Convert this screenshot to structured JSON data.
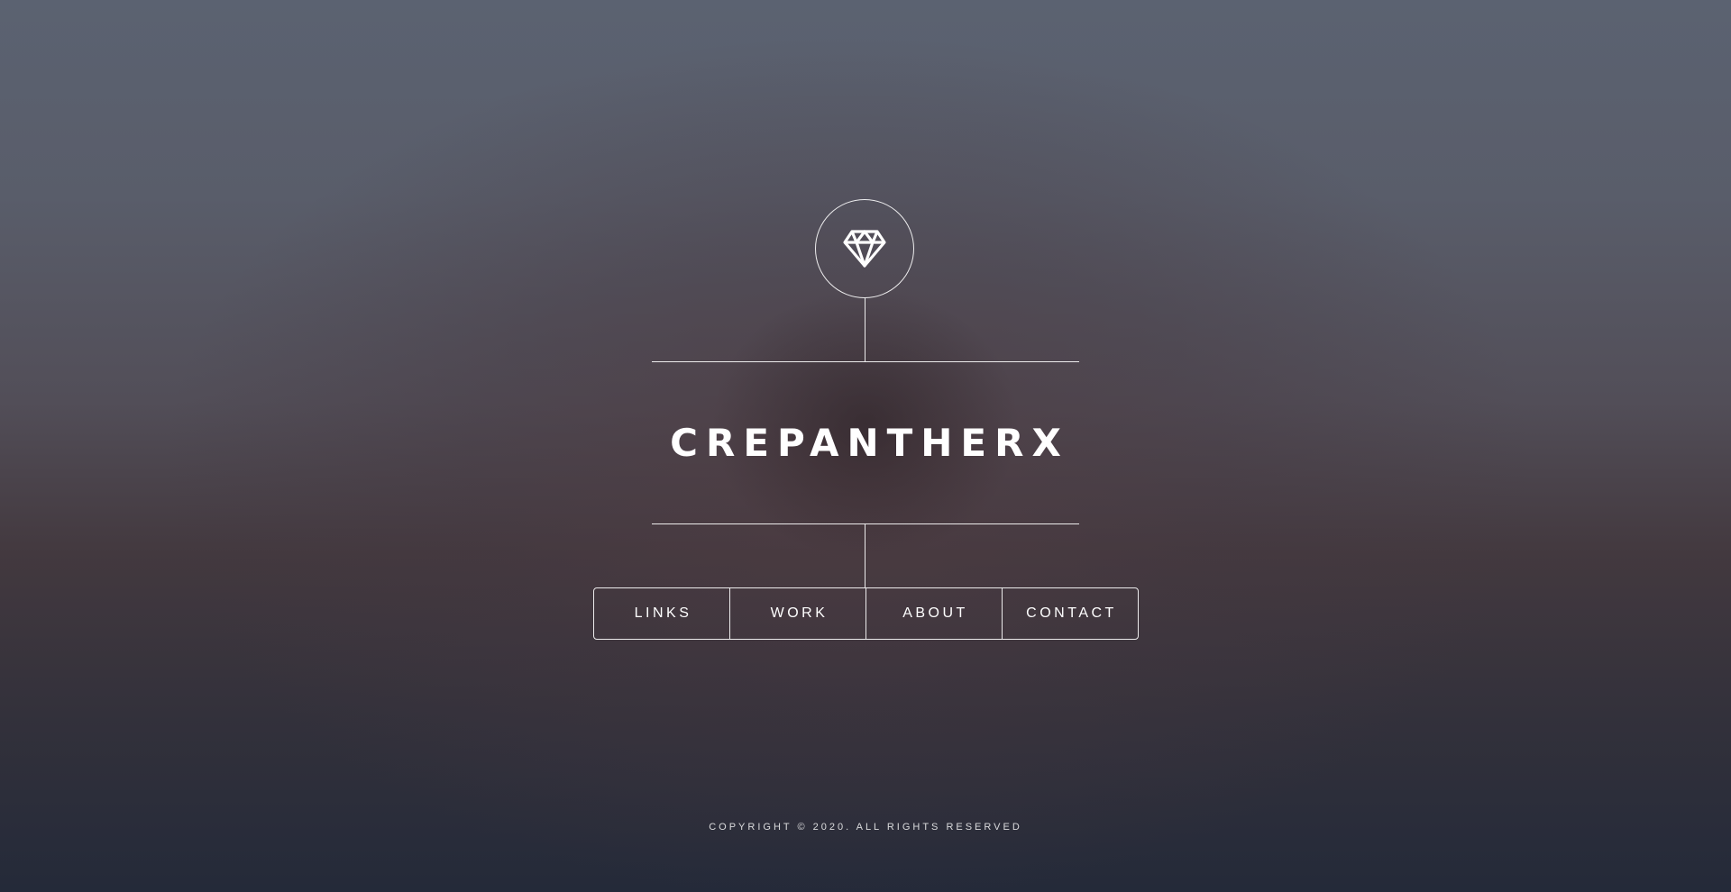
{
  "header": {
    "logo_icon": "diamond-icon",
    "title": "CREPANTHERX"
  },
  "nav": {
    "items": [
      {
        "label": "LINKS"
      },
      {
        "label": "WORK"
      },
      {
        "label": "ABOUT"
      },
      {
        "label": "CONTACT"
      }
    ]
  },
  "footer": {
    "copyright": "COPYRIGHT © 2020. ALL RIGHTS RESERVED"
  },
  "colors": {
    "foreground": "#ffffff",
    "background_top": "#5b6271",
    "background_bottom": "#242a39"
  }
}
